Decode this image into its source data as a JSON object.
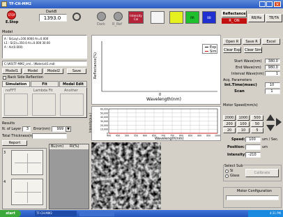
{
  "window": {
    "title": "TF-CH-MM2"
  },
  "toolbar": {
    "stop_label": "E.Stop",
    "dark_label": "DarkB",
    "dark_value": "1393.0",
    "btn_dark": "Dark",
    "btn_ref": "R_Ref",
    "btn_colors": "Intensity Cal",
    "swatch_green": "RR",
    "swatch_blue": "BB",
    "swatch_yellow": "",
    "reflectance": "Reflectance",
    "measure_on": "R_ ON",
    "rb_label": "RB/Re",
    "tb_label": "TB/TA"
  },
  "model": {
    "title": "Model",
    "lines": [
      "A : Si(Lay)=100.0000  Ar=0.000",
      "L1 : Si(2)=350.0  Ar=0.000   30.00",
      "A : Air(0.000)"
    ],
    "path": "C:\\WS\\TF-MM2_cm\\...\\Material\\1.mdl",
    "tabs": [
      "Model1",
      "Model",
      "Model2",
      "Save"
    ],
    "back_side": "Back Side Reflection",
    "sim_tabs": [
      "Simulation",
      "Fit",
      "Model Edit"
    ],
    "sub_tabs": [
      "noFFT",
      "Lambda Fit",
      "Another"
    ]
  },
  "results": {
    "title": "Results",
    "n_of_layer_label": "N. of Layer",
    "n_of_layer_value": "3",
    "error_label": "Error(nm)",
    "error_value": "999",
    "total_thickness_label": "Total Thickness(nm)",
    "report_button": "Report",
    "table_col1": "BL(nm)",
    "table_col2": "RI(%)"
  },
  "chart1": {
    "ylabel": "Reflectance(%)",
    "xlabel": "Wavelength(nm)",
    "xtick": "0",
    "legend": [
      "Exp",
      "Sim"
    ]
  },
  "chart_data": {
    "type": "line",
    "title": "",
    "xlabel": "Wavelength(nm)",
    "ylabel": "Intensity(a.u.)",
    "x": [
      400,
      450,
      500,
      550,
      600,
      650,
      700,
      750,
      800,
      850,
      900,
      950,
      1000
    ],
    "xticklabels": [
      "400",
      "450",
      "500",
      "550",
      "600",
      "650",
      "700",
      "750",
      "800",
      "850",
      "900",
      "950",
      "1000"
    ],
    "yticklabels": [
      "60,000",
      "50,000",
      "40,000",
      "30,000",
      "20,000",
      "10,000",
      "0"
    ],
    "ylim": [
      0,
      60000
    ],
    "series": [
      {
        "values": [
          0,
          0,
          0,
          0,
          0,
          0,
          0,
          0,
          0,
          0,
          0,
          0,
          0
        ]
      }
    ],
    "grid": true
  },
  "right": {
    "open_label": "Open R",
    "save_label": "Save R",
    "excel_label": "Excel",
    "clear_exp": "Clear Exp",
    "clear_sim": "Clear Sim",
    "start_wave_label": "Start Wave(nm)",
    "start_wave_value": "380.0",
    "end_wave_label": "End Wave(nm)",
    "end_wave_value": "980.0",
    "interval_label": "Interval Wave(nm)",
    "interval_value": "1",
    "acq_title": "Acq. Parameters",
    "int_time_label": "Int.Time(msec)",
    "int_time_value": "10",
    "scan_label": "Scan",
    "scan_value": "1",
    "motor_speed_title": "Motor Speed(mm/s)",
    "speed_grid": [
      "2000",
      "1000",
      "500",
      "200",
      "100",
      "50",
      "20",
      "10",
      "5"
    ],
    "speed_label": "Speed:",
    "speed_value": "100",
    "speed_unit": "um / Sec.",
    "position_label": "Position:",
    "position_value": "",
    "position_unit": "um",
    "intensity_label": "Intensity:",
    "intensity_value": "-210",
    "select_sub_title": "Select Sub",
    "sub_options": [
      "Si",
      "Glass"
    ],
    "calibrate": "Calibrate",
    "motor_config": "Motor Configuration"
  },
  "taskbar": {
    "start": "start",
    "items": [
      "TF-CH-MM2",
      ""
    ],
    "clock": "4:31 PM"
  }
}
